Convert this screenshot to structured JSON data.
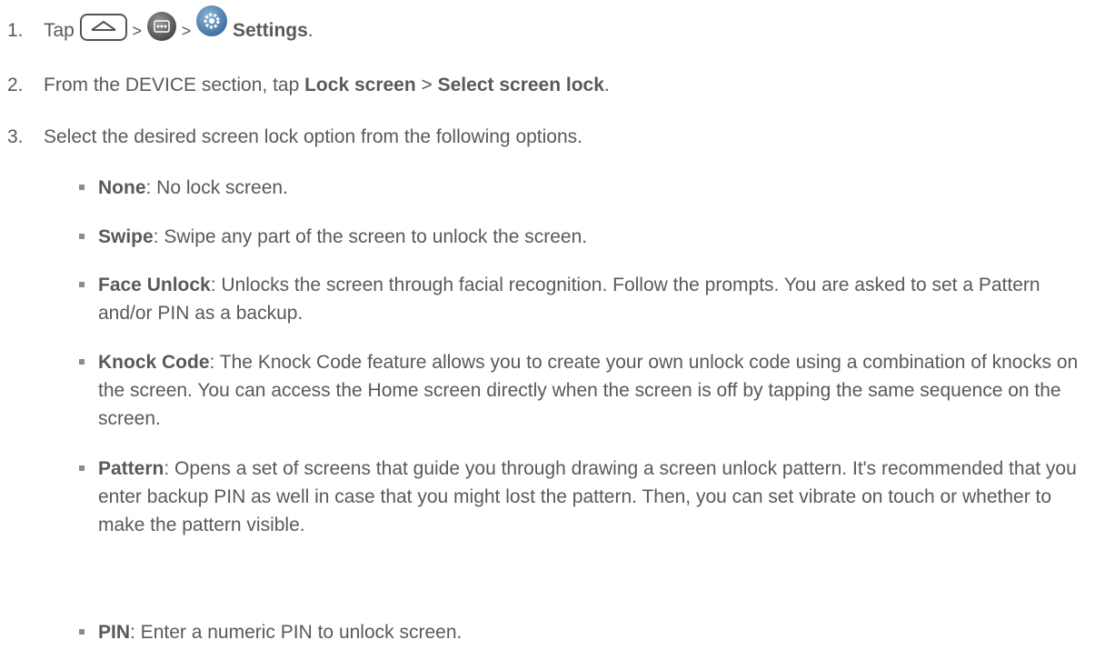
{
  "steps": [
    {
      "num": "1.",
      "pre": "Tap",
      "sep1": ">",
      "sep2": ">",
      "bold": "Settings",
      "post": "."
    },
    {
      "num": "2.",
      "text1": "From the DEVICE section, tap ",
      "bold1": "Lock screen",
      "text2": " > ",
      "bold2": "Select screen lock",
      "post": "."
    },
    {
      "num": "3.",
      "text": "Select the desired screen lock option from the following options."
    }
  ],
  "options": [
    {
      "label": "None",
      "text": ": No lock screen."
    },
    {
      "label": "Swipe",
      "text": ": Swipe any part of the screen to unlock the screen."
    },
    {
      "label": "Face Unlock",
      "text": ": Unlocks the screen through facial recognition. Follow the prompts. You are asked to set a Pattern and/or PIN as a backup."
    },
    {
      "label": "Knock Code",
      "text": ": The Knock Code feature allows you to create your own unlock code using a combination of knocks on the screen. You can access the Home screen directly when the screen is off by tapping the same sequence on the screen."
    },
    {
      "label": "Pattern",
      "text": ": Opens a set of screens that guide you through drawing a screen unlock pattern. It's recommended that you enter backup PIN as well in case that you might lost the pattern. Then, you can set vibrate on touch or whether to make the pattern visible."
    },
    {
      "label": "PIN",
      "text": ": Enter a numeric PIN to unlock screen."
    }
  ],
  "icons": [
    "home-key-icon",
    "apps-icon",
    "settings-gear-icon"
  ]
}
